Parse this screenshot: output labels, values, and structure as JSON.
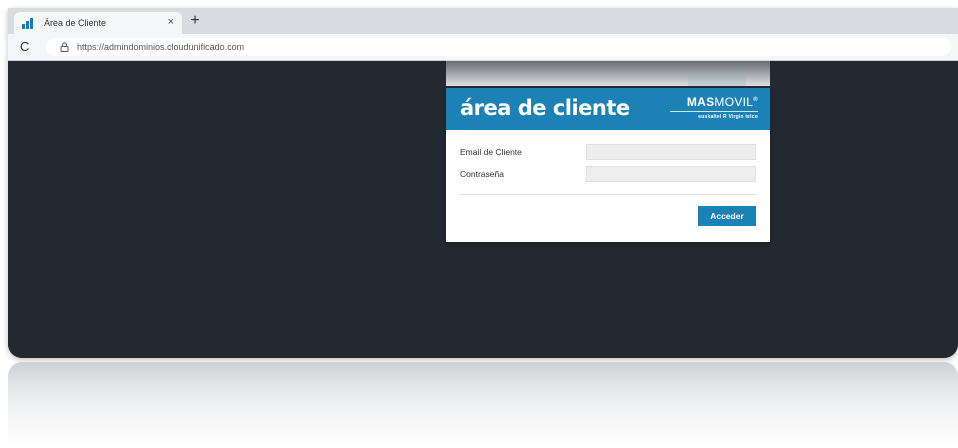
{
  "browser": {
    "tab_title": "Área de Cliente",
    "tab_close": "×",
    "new_tab": "+",
    "reload": "C",
    "url": "https://admindominios.cloudunificado.com"
  },
  "login": {
    "title": "área de cliente",
    "brand": {
      "main_bold": "MAS",
      "main_light": "MOVIL",
      "reg_mark": "®",
      "sub": "euskaltel  R  Virgin telco"
    },
    "email_label": "Email de Cliente",
    "email_value": "",
    "password_label": "Contraseña",
    "password_value": "",
    "submit_label": "Acceder"
  },
  "colors": {
    "page_background": "#222931",
    "accent": "#1c81b5"
  }
}
